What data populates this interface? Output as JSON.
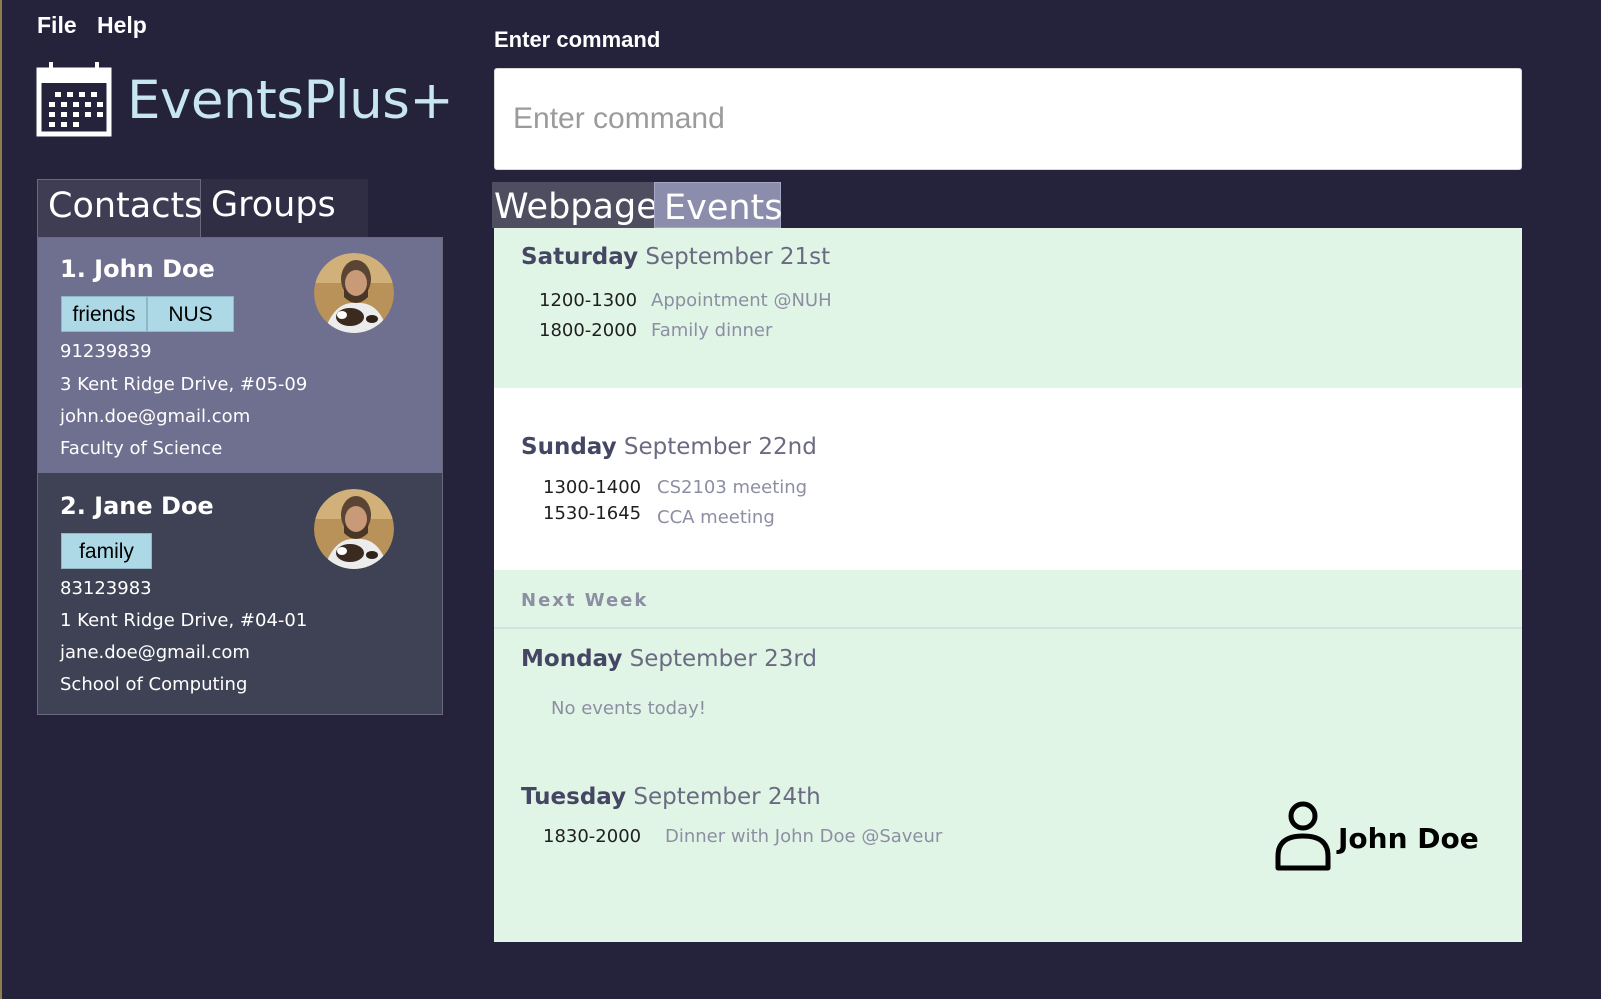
{
  "menu": {
    "file_label": "File",
    "help_label": "Help"
  },
  "app": {
    "title": "EventsPlus+",
    "logo_icon": "calendar-icon"
  },
  "left_tabs": {
    "contacts_label": "Contacts",
    "groups_label": "Groups",
    "selected": "Contacts"
  },
  "contacts": [
    {
      "name": "1. John Doe",
      "tags": [
        "friends",
        "NUS"
      ],
      "phone": "91239839",
      "address": "3 Kent Ridge Drive, #05-09",
      "email": "john.doe@gmail.com",
      "faculty": "Faculty of Science",
      "selected": true
    },
    {
      "name": "2. Jane Doe",
      "tags": [
        "family"
      ],
      "phone": "83123983",
      "address": "1 Kent Ridge Drive, #04-01",
      "email": "jane.doe@gmail.com",
      "faculty": "School of Computing",
      "selected": false
    }
  ],
  "command": {
    "label": "Enter command",
    "placeholder": "Enter command",
    "value": ""
  },
  "right_tabs": {
    "webpage_label": "Webpage",
    "events_label": "Events",
    "selected": "Events"
  },
  "events": {
    "days": [
      {
        "day": "Saturday",
        "date": "September 21st",
        "items": [
          {
            "time": "1200-1300",
            "title": "Appointment @NUH"
          },
          {
            "time": "1800-2000",
            "title": "Family dinner"
          }
        ]
      },
      {
        "day": "Sunday",
        "date": "September 22nd",
        "items": [
          {
            "time": "1300-1400",
            "title": "CS2103 meeting"
          },
          {
            "time": "1530-1645",
            "title": "CCA meeting"
          }
        ]
      }
    ],
    "next_week_label": "Next Week",
    "next_week_days": [
      {
        "day": "Monday",
        "date": "September 23rd",
        "empty_text": "No events today!"
      },
      {
        "day": "Tuesday",
        "date": "September 24th",
        "items": [
          {
            "time": "1830-2000",
            "title": "Dinner with John Doe @Saveur"
          }
        ]
      }
    ],
    "current_user": "John Doe",
    "user_icon": "person-icon"
  },
  "colors": {
    "background": "#25233b",
    "events_background": "#e0f5e6",
    "tag": "#add8e6",
    "selected_card": "#6f6f8f",
    "selected_tab": "#8c8dad"
  }
}
